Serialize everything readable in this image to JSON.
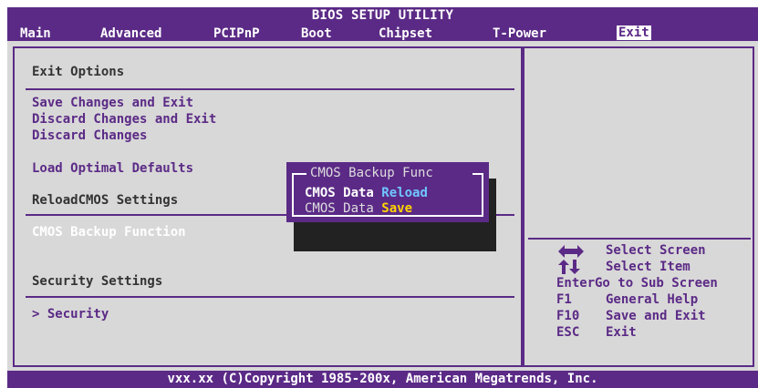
{
  "bios": {
    "title": "BIOS SETUP UTILITY",
    "menu": [
      {
        "label": "Main"
      },
      {
        "label": "Advanced"
      },
      {
        "label": "PCIPnP"
      },
      {
        "label": "Boot"
      },
      {
        "label": "Chipset"
      },
      {
        "label": "T-Power"
      },
      {
        "label": "Exit",
        "active": true
      }
    ]
  },
  "left_panel": {
    "header": "Exit Options",
    "items": [
      "Save Changes and Exit",
      "Discard Changes and Exit",
      "Discard Changes",
      "Load Optimal Defaults",
      "ReloadCMOS Settings",
      "CMOS Backup Function",
      "Security Settings",
      "> Security"
    ]
  },
  "popup": {
    "title": "CMOS Backup Func",
    "options": [
      {
        "prefix": "CMOS Data ",
        "keyword": "Reload",
        "selected": true
      },
      {
        "prefix": "CMOS Data ",
        "keyword": "Save",
        "selected": false
      }
    ]
  },
  "help": {
    "rows": [
      {
        "key": "",
        "desc": "Select Screen",
        "icon": "left-right-arrow-icon"
      },
      {
        "key": "",
        "desc": "Select Item",
        "icon": "up-down-arrow-icon"
      },
      {
        "key": "Enter",
        "desc": "Go to Sub Screen"
      },
      {
        "key": "F1",
        "desc": "General Help"
      },
      {
        "key": "F10",
        "desc": "Save and Exit"
      },
      {
        "key": "ESC",
        "desc": "Exit"
      }
    ]
  },
  "footer": {
    "text": "vxx.xx (C)Copyright 1985-200x, American Megatrends, Inc."
  },
  "colors": {
    "bios_purple": "#5b2a86",
    "panel_gray": "#d8d8d8",
    "popup_reload": "#6fc6ff",
    "popup_save": "#ffd400"
  }
}
